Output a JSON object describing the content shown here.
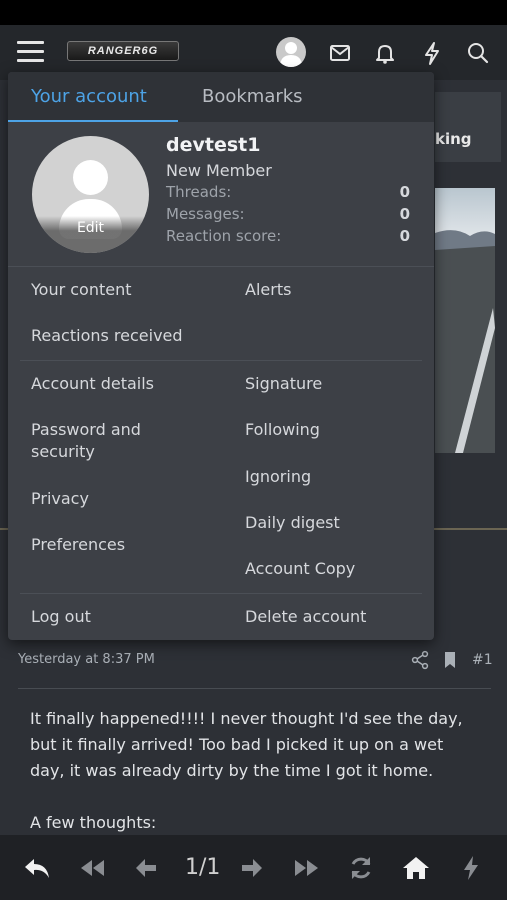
{
  "nav": {
    "logo_text": "RANGER6G"
  },
  "background": {
    "card_text": "king",
    "post": {
      "timestamp": "Yesterday at 8:37 PM",
      "post_number": "#1",
      "body": [
        "It finally happened!!!! I never thought I'd see the day, but it finally arrived! Too bad I picked it up on a wet day, it was already dirty by the time I got it home.",
        "A few thoughts:"
      ]
    }
  },
  "bottom_bar": {
    "page_count": "1/1"
  },
  "dropdown": {
    "tabs": [
      {
        "label": "Your account",
        "active": true
      },
      {
        "label": "Bookmarks",
        "active": false
      }
    ],
    "avatar_edit_label": "Edit",
    "username": "devtest1",
    "user_title": "New Member",
    "stats": [
      {
        "label": "Threads:",
        "value": "0"
      },
      {
        "label": "Messages:",
        "value": "0"
      },
      {
        "label": "Reaction score:",
        "value": "0"
      }
    ],
    "menu": {
      "your_content": "Your content",
      "alerts": "Alerts",
      "reactions_received": "Reactions received",
      "account_details": "Account details",
      "signature": "Signature",
      "password_security": "Password and security",
      "following": "Following",
      "ignoring": "Ignoring",
      "privacy": "Privacy",
      "daily_digest": "Daily digest",
      "preferences": "Preferences",
      "account_copy": "Account Copy",
      "log_out": "Log out",
      "delete_account": "Delete account"
    }
  },
  "colors": {
    "accent": "#4da3e6",
    "panel": "#3d4046",
    "nav": "#24272b",
    "page": "#2d3036"
  },
  "icons": [
    "hamburger-icon",
    "avatar-icon",
    "mail-icon",
    "bell-icon",
    "bolt-icon",
    "search-icon",
    "share-icon",
    "bookmark-icon",
    "reply-icon",
    "first-page-icon",
    "prev-page-icon",
    "next-page-icon",
    "last-page-icon",
    "refresh-icon",
    "home-icon",
    "bolt-icon"
  ]
}
